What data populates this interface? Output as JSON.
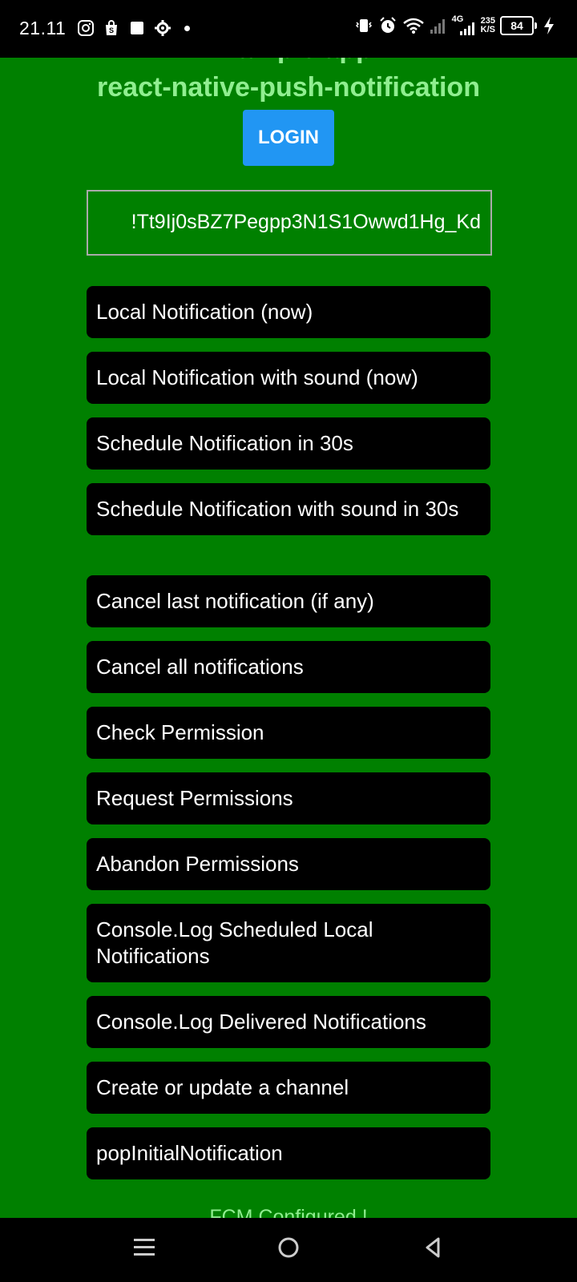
{
  "status_bar": {
    "time": "21.11",
    "left_icons": [
      "instagram-icon",
      "shopping-bag-icon",
      "square-icon",
      "settings-icon",
      "dot-icon"
    ],
    "network_type": "4G",
    "speed_value": "235",
    "speed_unit": "K/S",
    "battery": "84"
  },
  "header": {
    "title_partial": "Example app",
    "title": "react-native-push-notification"
  },
  "login_button": "LOGIN",
  "token_field": {
    "value": "!Tt9Ij0sBZ7Pegpp3N1S1Owwd1Hg_Kd"
  },
  "buttons": [
    "Local Notification (now)",
    "Local Notification with sound (now)",
    "Schedule Notification in 30s",
    "Schedule Notification with sound in 30s",
    "Cancel last notification (if any)",
    "Cancel all notifications",
    "Check Permission",
    "Request Permissions",
    "Abandon Permissions",
    "Console.Log Scheduled Local Notifications",
    "Console.Log Delivered Notifications",
    "Create or update a channel",
    "popInitialNotification"
  ],
  "footer_status": "FCM Configured !",
  "nav_bar": {
    "icons": [
      "menu-icon",
      "home-icon",
      "back-icon"
    ]
  },
  "colors": {
    "background": "#008000",
    "title": "#90EE90",
    "login": "#2196F3",
    "button": "#000000"
  }
}
